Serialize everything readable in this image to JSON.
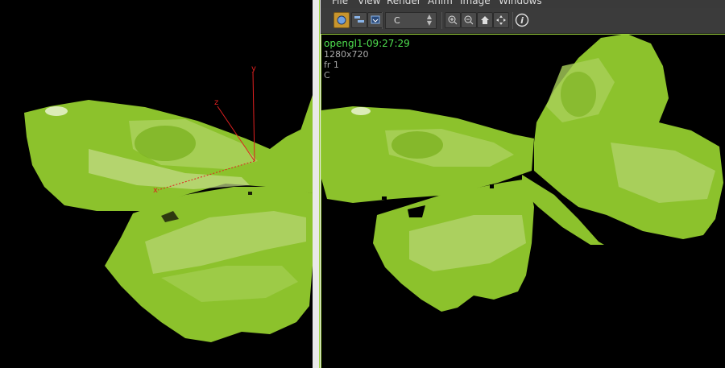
{
  "menu": {
    "items": [
      {
        "label": "File"
      },
      {
        "label": "View"
      },
      {
        "label": "Render"
      },
      {
        "label": "Anim"
      },
      {
        "label": "Image"
      },
      {
        "label": "Windows"
      }
    ]
  },
  "toolbar": {
    "channel": "C",
    "icons": [
      "display-icon",
      "layers-icon",
      "export-icon",
      "zoom-in-icon",
      "zoom-out-icon",
      "home-icon",
      "fit-icon",
      "info-icon"
    ]
  },
  "viewer": {
    "render_name": "opengl1-09:27:29",
    "resolution": "1280x720",
    "frame": "fr 1",
    "channel": "C"
  },
  "left_viewport": {
    "axes": {
      "x": "x",
      "y": "y",
      "z": "z"
    }
  },
  "colors": {
    "wing_green": "#8cc22c",
    "wing_light": "#c4dc8a",
    "axis_red": "#e02020",
    "title_green": "#4fe04f"
  }
}
